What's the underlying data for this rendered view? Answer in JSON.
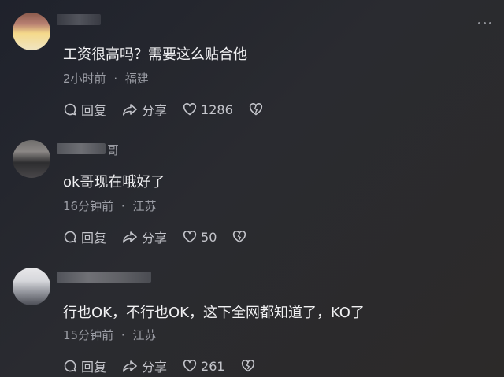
{
  "comments": [
    {
      "text": "工资很高吗？需要这么贴合他",
      "time": "2小时前",
      "location": "福建",
      "reply_label": "回复",
      "share_label": "分享",
      "likes": "1286",
      "name_tail": ""
    },
    {
      "text": "ok哥现在哦好了",
      "time": "16分钟前",
      "location": "江苏",
      "reply_label": "回复",
      "share_label": "分享",
      "likes": "50",
      "name_tail": "哥"
    },
    {
      "text": "行也OK，不行也OK，这下全网都知道了，KO了",
      "time": "15分钟前",
      "location": "江苏",
      "reply_label": "回复",
      "share_label": "分享",
      "likes": "261",
      "name_tail": ""
    }
  ],
  "meta_separator": "·",
  "icons": {
    "reply": "comment-bubble-icon",
    "share": "share-arrow-icon",
    "like": "heart-icon",
    "dislike": "broken-heart-icon",
    "more": "more-dots-icon"
  }
}
